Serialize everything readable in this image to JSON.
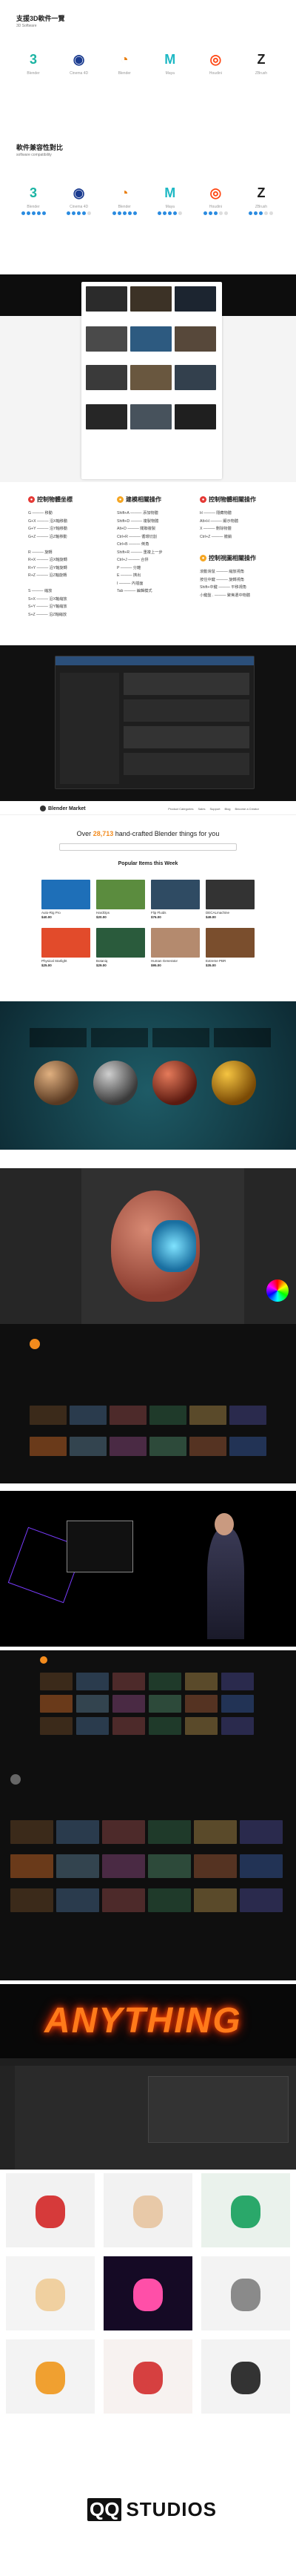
{
  "sec1": {
    "title": "支援3D軟件一覽",
    "subtitle": "3D Software",
    "logos": [
      {
        "label": "Blender",
        "icon": "blender-like-icon",
        "glyph": "3",
        "color": "#1bb4a3"
      },
      {
        "label": "Cinema 4D",
        "icon": "cinema4d-icon",
        "glyph": "◉",
        "color": "#1a3b8f"
      },
      {
        "label": "Blender",
        "icon": "blender-icon",
        "glyph": "◔",
        "color": "#e87d0d"
      },
      {
        "label": "Maya",
        "icon": "maya-icon",
        "glyph": "M",
        "color": "#1eb8c4"
      },
      {
        "label": "Houdini",
        "icon": "houdini-icon",
        "glyph": "◎",
        "color": "#ff4713"
      },
      {
        "label": "ZBrush",
        "icon": "zbrush-icon",
        "glyph": "Z",
        "color": "#222222"
      }
    ]
  },
  "sec2": {
    "title": "軟件兼容性對比",
    "subtitle": "software compatibility",
    "logos": [
      {
        "label": "Blender",
        "icon": "blender-like-icon",
        "glyph": "3",
        "color": "#1bb4a3",
        "score": 5
      },
      {
        "label": "Cinema 4D",
        "icon": "cinema4d-icon",
        "glyph": "◉",
        "color": "#1a3b8f",
        "score": 4
      },
      {
        "label": "Blender",
        "icon": "blender-icon",
        "glyph": "◔",
        "color": "#e87d0d",
        "score": 5
      },
      {
        "label": "Maya",
        "icon": "maya-icon",
        "glyph": "M",
        "color": "#1eb8c4",
        "score": 4
      },
      {
        "label": "Houdini",
        "icon": "houdini-icon",
        "glyph": "◎",
        "color": "#ff4713",
        "score": 3
      },
      {
        "label": "ZBrush",
        "icon": "zbrush-icon",
        "glyph": "Z",
        "color": "#222222",
        "score": 3
      }
    ]
  },
  "shortcuts": {
    "col1": {
      "title": "控制物體坐標",
      "color": "#e53935",
      "items": [
        "G ——— 移動",
        "G+X ——— 沿X軸移動",
        "G+Y ——— 沿Y軸移動",
        "G+Z ——— 沿Z軸移動",
        "",
        "R ——— 旋轉",
        "R+X ——— 沿X軸旋轉",
        "R+Y ——— 沿Y軸旋轉",
        "R+Z ——— 沿Z軸旋轉",
        "",
        "S ——— 縮放",
        "S+X ——— 沿X軸縮放",
        "S+Y ——— 沿Y軸縮放",
        "S+Z ——— 沿Z軸縮放"
      ]
    },
    "col2": {
      "title": "建模相關操作",
      "color": "#f5a623",
      "items": [
        "Shift+A ——— 添加物體",
        "Shift+D ——— 複製物體",
        "Alt+D ——— 關聯複製",
        "Ctrl+R ——— 循環切割",
        "Ctrl+B ——— 倒角",
        "Shift+R ——— 重複上一步",
        "Ctrl+J ——— 合併",
        "P ——— 分離",
        "E ——— 擠出",
        "I ——— 內插面",
        "Tab ——— 編輯模式"
      ]
    },
    "col3": {
      "title": "控制物體相關操作",
      "color": "#e53935",
      "items": [
        "H ——— 隱藏物體",
        "Alt+H ——— 顯示物體",
        "X ——— 刪除物體",
        "Ctrl+Z ——— 撤銷"
      ]
    },
    "col4": {
      "title": "控制視圖相關操作",
      "color": "#f5a623",
      "items": [
        "滾動滑鼠 ——— 縮放視角",
        "按住中鍵 ——— 旋轉視角",
        "Shift+中鍵 ——— 平移視角",
        "小鍵盤 . ——— 聚焦選中物體"
      ]
    }
  },
  "market": {
    "brand": "Blender Market",
    "headline_pre": "Over",
    "headline_num": "28,713",
    "headline_post": "hand-crafted Blender things for you",
    "popular": "Popular Items this Week",
    "nav": [
      "Product Categories",
      "Sales",
      "Support",
      "Blog",
      "Become a Creator"
    ],
    "items": [
      {
        "title": "Auto-Rig Pro",
        "price": "$40.00",
        "color": "#1e6fb8"
      },
      {
        "title": "HardOps",
        "price": "$20.00",
        "color": "#5b8c3e"
      },
      {
        "title": "Flip Fluids",
        "price": "$76.00",
        "color": "#2f4b63"
      },
      {
        "title": "DECALmachine",
        "price": "$49.00",
        "color": "#333333"
      },
      {
        "title": "Physical Starlight",
        "price": "$25.00",
        "color": "#e24b2b"
      },
      {
        "title": "Botaniq",
        "price": "$29.00",
        "color": "#2a5b3c"
      },
      {
        "title": "Human Generator",
        "price": "$95.00",
        "color": "#b48a6e"
      },
      {
        "title": "Extreme PBR",
        "price": "$35.00",
        "color": "#7a4e2d"
      }
    ]
  },
  "anything": {
    "text": "ANYTHING"
  },
  "footer": {
    "logo_a": "QQ",
    "logo_b": "STUDIOS"
  }
}
